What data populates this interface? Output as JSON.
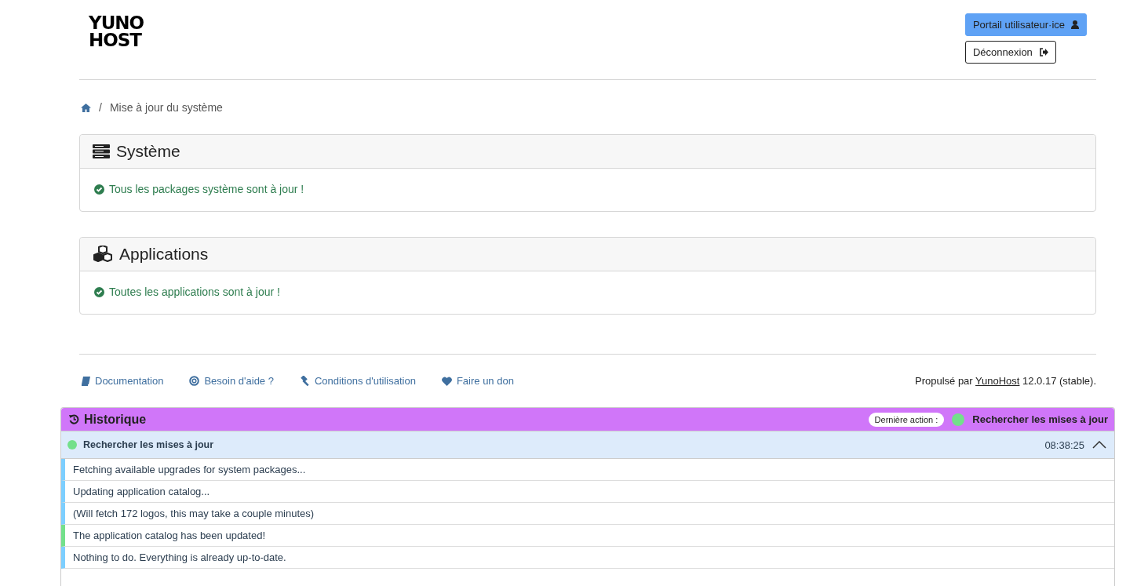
{
  "header": {
    "logo": [
      "YUNO",
      "HOST"
    ],
    "buttons": [
      {
        "label": "Portail utilisateur·ice",
        "kind": "primary"
      },
      {
        "label": "Déconnexion",
        "kind": "outline"
      }
    ]
  },
  "breadcrumb": {
    "separator": "/",
    "items": [
      "Mise à jour du système"
    ]
  },
  "cards": [
    {
      "title": "Système",
      "message": "Tous les packages système sont à jour !"
    },
    {
      "title": "Applications",
      "message": "Toutes les applications sont à jour !"
    }
  ],
  "footer": {
    "links": [
      {
        "label": "Documentation"
      },
      {
        "label": "Besoin d'aide ?"
      },
      {
        "label": "Conditions d'utilisation"
      },
      {
        "label": "Faire un don"
      }
    ],
    "powered_prefix": "Propulsé par",
    "powered_link": "YunoHost",
    "powered_suffix": "12.0.17 (stable)."
  },
  "history": {
    "title": "Historique",
    "last_action_label": "Dernière action :",
    "last_action": "Rechercher les mises à jour",
    "operation": {
      "title": "Rechercher les mises à jour",
      "time": "08:38:25",
      "expanded": true,
      "messages": [
        {
          "text": "Fetching available upgrades for system packages...",
          "kind": "info"
        },
        {
          "text": "Updating application catalog...",
          "kind": "info"
        },
        {
          "text": "(Will fetch 172 logos, this may take a couple minutes)",
          "kind": "info"
        },
        {
          "text": "The application catalog has been updated!",
          "kind": "success"
        },
        {
          "text": "Nothing to do. Everything is already up-to-date.",
          "kind": "info"
        }
      ]
    }
  }
}
